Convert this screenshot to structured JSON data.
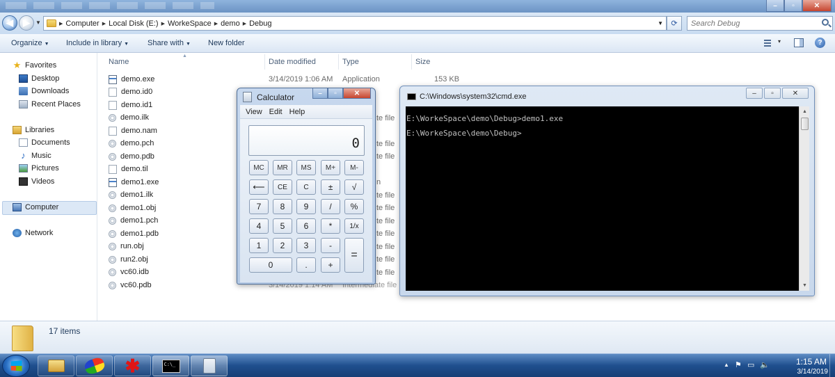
{
  "explorer": {
    "address": {
      "crumbs": [
        "Computer",
        "Local Disk (E:)",
        "WorkeSpace",
        "demo",
        "Debug"
      ]
    },
    "search": {
      "placeholder": "Search Debug"
    },
    "toolbar": {
      "organize": "Organize",
      "include_in_library": "Include in library",
      "share_with": "Share with",
      "new_folder": "New folder"
    },
    "nav": {
      "favorites": "Favorites",
      "desktop": "Desktop",
      "downloads": "Downloads",
      "recent_places": "Recent Places",
      "libraries": "Libraries",
      "documents": "Documents",
      "music": "Music",
      "pictures": "Pictures",
      "videos": "Videos",
      "computer": "Computer",
      "network": "Network"
    },
    "columns": {
      "name": "Name",
      "date": "Date modified",
      "type": "Type",
      "size": "Size"
    },
    "files": [
      {
        "name": "demo.exe",
        "date": "3/14/2019 1:06 AM",
        "type": "Application",
        "size": "153 KB",
        "icon": "exe"
      },
      {
        "name": "demo.id0",
        "icon": "blank"
      },
      {
        "name": "demo.id1",
        "icon": "blank"
      },
      {
        "name": "demo.ilk",
        "icon": "gen"
      },
      {
        "name": "demo.nam",
        "icon": "blank"
      },
      {
        "name": "demo.pch",
        "type_tail": "te file",
        "icon": "gen"
      },
      {
        "name": "demo.pdb",
        "type_tail": "te file",
        "icon": "gen"
      },
      {
        "name": "demo.til",
        "icon": "blank"
      },
      {
        "name": "demo1.exe",
        "type_tail": "n",
        "icon": "exe"
      },
      {
        "name": "demo1.ilk",
        "type_tail": "te file",
        "icon": "gen"
      },
      {
        "name": "demo1.obj",
        "type_tail": "te file",
        "icon": "gen"
      },
      {
        "name": "demo1.pch",
        "type_tail": "te file",
        "icon": "gen"
      },
      {
        "name": "demo1.pdb",
        "type_tail": "te file",
        "icon": "gen"
      },
      {
        "name": "run.obj",
        "type_tail": "te file",
        "icon": "gen"
      },
      {
        "name": "run2.obj",
        "type_tail": "te file",
        "icon": "gen"
      },
      {
        "name": "vc60.idb",
        "type_tail": "te file",
        "icon": "gen"
      },
      {
        "name": "vc60.pdb",
        "date": "3/14/2019 1:14 AM",
        "type": "Intermediate file",
        "icon": "gen"
      }
    ],
    "status": {
      "item_count": "17 items"
    }
  },
  "calculator": {
    "title": "Calculator",
    "menu": {
      "view": "View",
      "edit": "Edit",
      "help": "Help"
    },
    "display": "0",
    "keys": {
      "mc": "MC",
      "mr": "MR",
      "ms": "MS",
      "mplus": "M+",
      "mminus": "M-",
      "back": "⟵",
      "ce": "CE",
      "c": "C",
      "plusminus": "±",
      "sqrt": "√",
      "k7": "7",
      "k8": "8",
      "k9": "9",
      "div": "/",
      "pct": "%",
      "k4": "4",
      "k5": "5",
      "k6": "6",
      "mul": "*",
      "recip": "1/x",
      "k1": "1",
      "k2": "2",
      "k3": "3",
      "minus": "-",
      "eq": "=",
      "k0": "0",
      "dot": ".",
      "plus": "+"
    }
  },
  "cmd": {
    "title": "C:\\Windows\\system32\\cmd.exe",
    "lines": [
      "E:\\WorkeSpace\\demo\\Debug>demo1.exe",
      "E:\\WorkeSpace\\demo\\Debug>"
    ]
  },
  "taskbar": {
    "time": "1:15 AM",
    "date": "3/14/2019"
  }
}
